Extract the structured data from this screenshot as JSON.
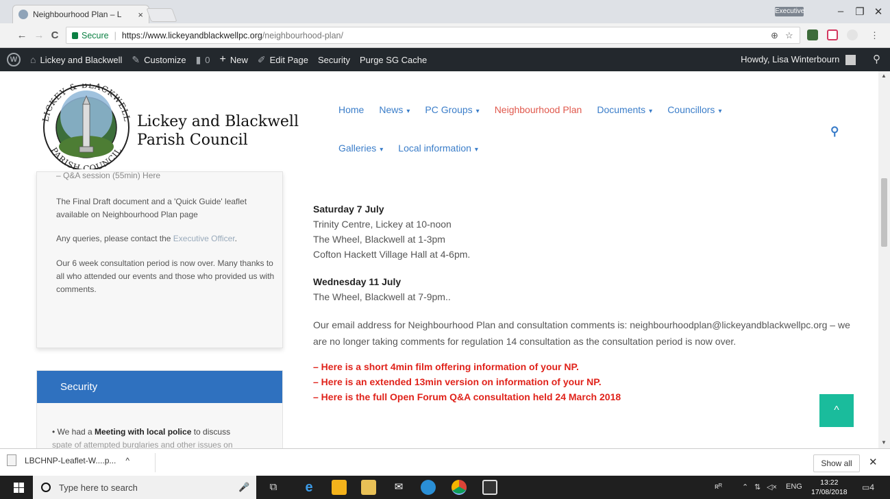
{
  "browser": {
    "tab_title": "Neighbourhood Plan – L",
    "tab_close": "×",
    "profile_badge": "Executive",
    "minimize": "–",
    "restore": "❐",
    "close": "✕",
    "back": "←",
    "forward": "→",
    "reload": "C",
    "secure_label": "Secure",
    "url_separator": "|",
    "url_host": "https://www.lickeyandblackwellpc.org",
    "url_path": "/neighbourhood-plan/",
    "zoom_icon": "⊕",
    "star_icon": "☆",
    "menu_icon": "⋮"
  },
  "admin_bar": {
    "wp_logo": "W",
    "site_name": "Lickey and Blackwell",
    "customize": "Customize",
    "comments_count": "0",
    "new": "New",
    "edit_page": "Edit Page",
    "security": "Security",
    "purge": "Purge SG Cache",
    "howdy": "Howdy, Lisa Winterbourn"
  },
  "header": {
    "title_line1": "Lickey and Blackwell",
    "title_line2": "Parish Council",
    "logo_top_text": "LICKEY & BLACKWELL",
    "logo_bottom_text": "PARISH COUNCIL",
    "nav_row1": [
      {
        "label": "Home",
        "dropdown": false
      },
      {
        "label": "News",
        "dropdown": true
      },
      {
        "label": "PC Groups",
        "dropdown": true
      },
      {
        "label": "Neighbourhood Plan",
        "dropdown": false
      },
      {
        "label": "Documents",
        "dropdown": true
      },
      {
        "label": "Councillors",
        "dropdown": true
      }
    ],
    "nav_row2": [
      {
        "label": "Galleries",
        "dropdown": true
      },
      {
        "label": "Local information",
        "dropdown": true
      }
    ],
    "active_color": "#e0584c",
    "nav_color": "#3a7dc9"
  },
  "sidebar": {
    "cut_line": "– Q&A session (55min) Here",
    "para1": "The Final Draft document and a 'Quick Guide' leaflet available on Neighbourhood Plan page",
    "para2_prefix": "Any queries, please contact the ",
    "para2_link": "Executive Officer",
    "para2_suffix": ".",
    "para3": "Our 6 week consultation period is now over.  Many thanks to all who attended our events and those who provided us with comments.",
    "security_heading": "Security",
    "security_prefix": "• We had a ",
    "security_bold": "Meeting with local police",
    "security_suffix": " to discuss",
    "security_cut": "spate of attempted burglaries and other  issues on"
  },
  "content": {
    "sat_heading": "Saturday 7 July",
    "sat_lines": [
      "Trinity Centre, Lickey at 10-noon",
      "The Wheel, Blackwell at 1-3pm",
      "Cofton Hackett Village Hall at 4-6pm."
    ],
    "wed_heading": "Wednesday 11 July",
    "wed_line": "The Wheel, Blackwell at 7-9pm..",
    "email_para": "Our email address for Neighbourhood Plan and consultation comments is: neighbourhoodplan@lickeyandblackwellpc.org – we are no longer taking comments for regulation 14 consultation as the consultation period is now over.",
    "links": [
      "– Here is a short 4min film offering information of your NP.",
      "– Here is an extended 13min version on information of your NP.",
      "– Here is the full Open Forum Q&A consultation held 24 March 2018"
    ],
    "to_top": "^"
  },
  "downloads": {
    "file": "LBCHNP-Leaflet-W....p...",
    "caret": "^",
    "show_all": "Show all",
    "close": "✕"
  },
  "taskbar": {
    "search_placeholder": "Type here to search",
    "lang": "ENG",
    "time": "13:22",
    "date": "17/08/2018",
    "notif_count": "4"
  }
}
